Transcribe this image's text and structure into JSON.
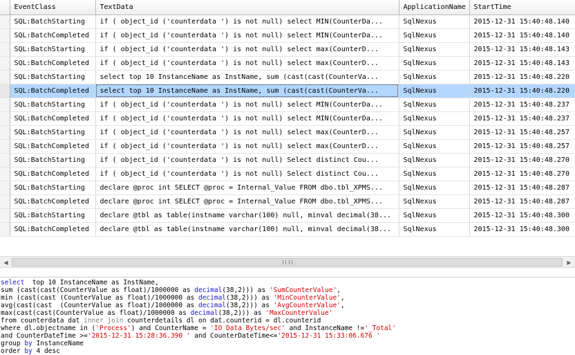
{
  "grid": {
    "columns": [
      "EventClass",
      "TextData",
      "ApplicationName",
      "StartTime"
    ],
    "rows": [
      {
        "event": "SQL:BatchStarting",
        "text": "if ( object_id ('counterdata ') is not null)   select MIN(CounterDa...",
        "app": "SqlNexus",
        "time": "2015-12-31 15:40:48.140"
      },
      {
        "event": "SQL:BatchCompleted",
        "text": "if ( object_id ('counterdata ') is not null)   select MIN(CounterDa...",
        "app": "SqlNexus",
        "time": "2015-12-31 15:40:48.140"
      },
      {
        "event": "SQL:BatchStarting",
        "text": " if ( object_id ('counterdata ') is not null)   select max(CounterD...",
        "app": "SqlNexus",
        "time": "2015-12-31 15:40:48.143"
      },
      {
        "event": "SQL:BatchCompleted",
        "text": " if ( object_id ('counterdata ') is not null)   select max(CounterD...",
        "app": "SqlNexus",
        "time": "2015-12-31 15:40:48.143"
      },
      {
        "event": "SQL:BatchStarting",
        "text": "select  top 10 InstanceName as InstName,   sum (cast(cast(CounterVa...",
        "app": "SqlNexus",
        "time": "2015-12-31 15:40:48.220"
      },
      {
        "event": "SQL:BatchCompleted",
        "text": "select  top 10 InstanceName as InstName,   sum (cast(cast(CounterVa...",
        "app": "SqlNexus",
        "time": "2015-12-31 15:40:48.220",
        "selected": true
      },
      {
        "event": "SQL:BatchStarting",
        "text": "if ( object_id ('counterdata ') is not null)   select MIN(CounterDa...",
        "app": "SqlNexus",
        "time": "2015-12-31 15:40:48.237"
      },
      {
        "event": "SQL:BatchCompleted",
        "text": "if ( object_id ('counterdata ') is not null)   select MIN(CounterDa...",
        "app": "SqlNexus",
        "time": "2015-12-31 15:40:48.237"
      },
      {
        "event": "SQL:BatchStarting",
        "text": " if ( object_id ('counterdata ') is not null)   select max(CounterD...",
        "app": "SqlNexus",
        "time": "2015-12-31 15:40:48.257"
      },
      {
        "event": "SQL:BatchCompleted",
        "text": " if ( object_id ('counterdata ') is not null)   select max(CounterD...",
        "app": "SqlNexus",
        "time": "2015-12-31 15:40:48.257"
      },
      {
        "event": "SQL:BatchStarting",
        "text": "if ( object_id ('counterdata ') is not null)   Select distinct  Cou...",
        "app": "SqlNexus",
        "time": "2015-12-31 15:40:48.270"
      },
      {
        "event": "SQL:BatchCompleted",
        "text": "if ( object_id ('counterdata ') is not null)   Select distinct  Cou...",
        "app": "SqlNexus",
        "time": "2015-12-31 15:40:48.270"
      },
      {
        "event": "SQL:BatchStarting",
        "text": "declare @proc int  SELECT @proc = Internal_Value  FROM dbo.tbl_XPMS...",
        "app": "SqlNexus",
        "time": "2015-12-31 15:40:48.287"
      },
      {
        "event": "SQL:BatchCompleted",
        "text": "declare @proc int  SELECT @proc = Internal_Value  FROM dbo.tbl_XPMS...",
        "app": "SqlNexus",
        "time": "2015-12-31 15:40:48.287"
      },
      {
        "event": "SQL:BatchStarting",
        "text": "declare @tbl as table(instname varchar(100) null, minval decimal(38...",
        "app": "SqlNexus",
        "time": "2015-12-31 15:40:48.300"
      },
      {
        "event": "SQL:BatchCompleted",
        "text": "declare @tbl as table(instname varchar(100) null, minval decimal(38...",
        "app": "SqlNexus",
        "time": "2015-12-31 15:40:48.300"
      }
    ]
  },
  "sql": {
    "lines": [
      [
        {
          "t": "select",
          "c": "kw"
        },
        {
          "t": "  top 10 InstanceName as InstName,"
        }
      ],
      [
        {
          "t": "sum (cast(cast(CounterValue as float)/1000000 as "
        },
        {
          "t": "decimal",
          "c": "kw"
        },
        {
          "t": "(38,2))) as "
        },
        {
          "t": "'SumCounterValue'",
          "c": "str"
        },
        {
          "t": ","
        }
      ],
      [
        {
          "t": "min (cast(cast (CounterValue as float)/1000000 as "
        },
        {
          "t": "decimal",
          "c": "kw"
        },
        {
          "t": "(38,2))) as "
        },
        {
          "t": "'MinCounterValue'",
          "c": "str"
        },
        {
          "t": ","
        }
      ],
      [
        {
          "t": "avg(cast(cast  (CounterValue as float)/1000000 as "
        },
        {
          "t": "decimal",
          "c": "kw"
        },
        {
          "t": "(38,2))) as "
        },
        {
          "t": "'AvgCounterValue'",
          "c": "str"
        },
        {
          "t": ","
        }
      ],
      [
        {
          "t": "max(cast(cast(CounterValue as float)/1000000 as "
        },
        {
          "t": "decimal",
          "c": "kw"
        },
        {
          "t": "(38,2))) as "
        },
        {
          "t": "'MaxCounterValue'",
          "c": "str"
        }
      ],
      [
        {
          "t": "from counterdata dat "
        },
        {
          "t": "inner join",
          "c": "op"
        },
        {
          "t": " counterdetails dl on dat.counterid = dl.counterid"
        }
      ],
      [
        {
          "t": "where dl.objectname in ("
        },
        {
          "t": "'Process'",
          "c": "str"
        },
        {
          "t": ") and CounterName = "
        },
        {
          "t": "'IO Data Bytes/sec'",
          "c": "str"
        },
        {
          "t": " and InstanceName !="
        },
        {
          "t": "'_Total'",
          "c": "str"
        }
      ],
      [
        {
          "t": "and CounterDateTime >="
        },
        {
          "t": "'2015-12-31 15:28:36.390 '",
          "c": "str"
        },
        {
          "t": " and CounterDateTime<="
        },
        {
          "t": "'2015-12-31 15:33:06.676 '",
          "c": "str"
        }
      ],
      [
        {
          "t": "group "
        },
        {
          "t": "by",
          "c": "kw"
        },
        {
          "t": " InstanceName"
        }
      ],
      [
        {
          "t": "order "
        },
        {
          "t": "by",
          "c": "kw"
        },
        {
          "t": " 4 desc"
        }
      ]
    ]
  },
  "scrollbar": {
    "left_arrow": "◀",
    "right_arrow": "▶"
  },
  "colors": {
    "selected_row": "#b3d7ff",
    "keyword": "#1515d6",
    "string": "#d40000"
  }
}
